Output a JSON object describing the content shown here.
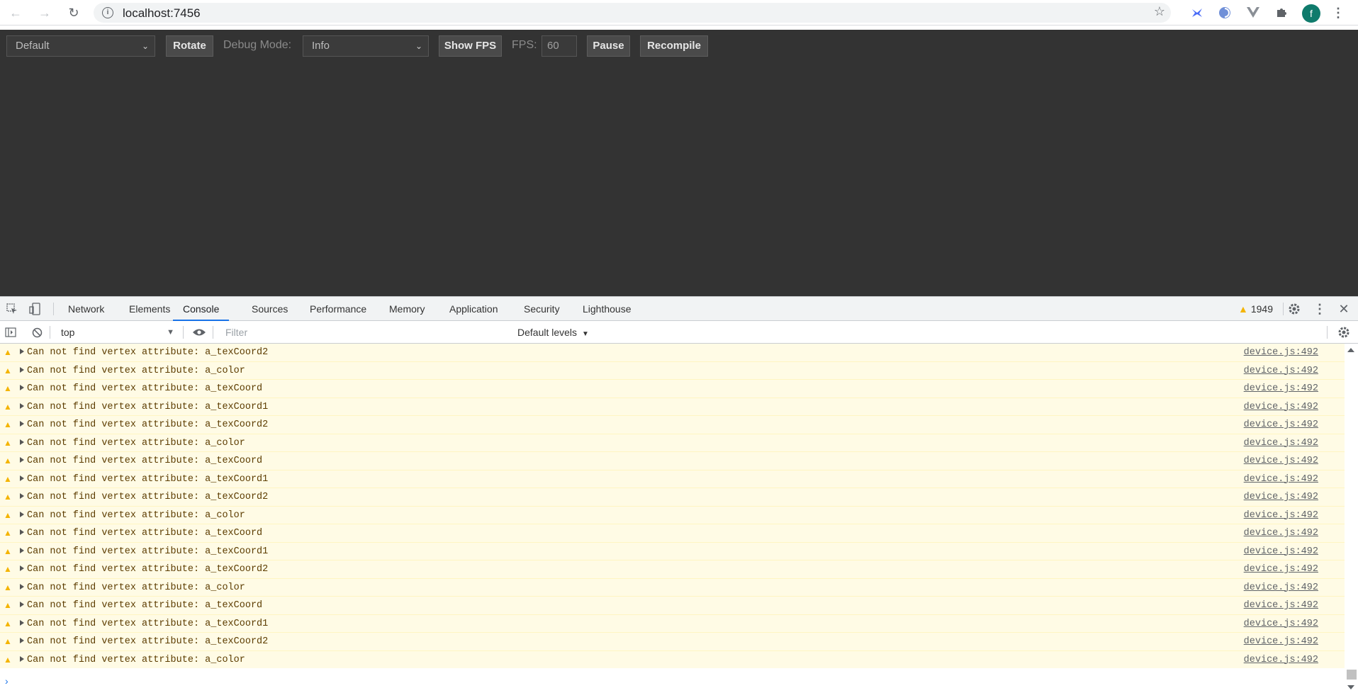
{
  "browser": {
    "url": "localhost:7456",
    "avatar_letter": "f"
  },
  "preview": {
    "scene_select": "Default",
    "rotate_label": "Rotate",
    "debug_mode_label": "Debug Mode:",
    "debug_mode_select": "Info",
    "show_fps_label": "Show FPS",
    "fps_label": "FPS:",
    "fps_value": "60",
    "pause_label": "Pause",
    "recompile_label": "Recompile"
  },
  "devtools": {
    "tabs": [
      "Network",
      "Elements",
      "Console",
      "Sources",
      "Performance",
      "Memory",
      "Application",
      "Security",
      "Lighthouse"
    ],
    "active_tab": "Console",
    "warning_count": "1949",
    "context": "top",
    "filter_placeholder": "Filter",
    "levels_label": "Default levels"
  },
  "console": {
    "messages": [
      {
        "text": "Can not find vertex attribute: a_texCoord2",
        "source": "device.js:492"
      },
      {
        "text": "Can not find vertex attribute: a_color",
        "source": "device.js:492"
      },
      {
        "text": "Can not find vertex attribute: a_texCoord",
        "source": "device.js:492"
      },
      {
        "text": "Can not find vertex attribute: a_texCoord1",
        "source": "device.js:492"
      },
      {
        "text": "Can not find vertex attribute: a_texCoord2",
        "source": "device.js:492"
      },
      {
        "text": "Can not find vertex attribute: a_color",
        "source": "device.js:492"
      },
      {
        "text": "Can not find vertex attribute: a_texCoord",
        "source": "device.js:492"
      },
      {
        "text": "Can not find vertex attribute: a_texCoord1",
        "source": "device.js:492"
      },
      {
        "text": "Can not find vertex attribute: a_texCoord2",
        "source": "device.js:492"
      },
      {
        "text": "Can not find vertex attribute: a_color",
        "source": "device.js:492"
      },
      {
        "text": "Can not find vertex attribute: a_texCoord",
        "source": "device.js:492"
      },
      {
        "text": "Can not find vertex attribute: a_texCoord1",
        "source": "device.js:492"
      },
      {
        "text": "Can not find vertex attribute: a_texCoord2",
        "source": "device.js:492"
      },
      {
        "text": "Can not find vertex attribute: a_color",
        "source": "device.js:492"
      },
      {
        "text": "Can not find vertex attribute: a_texCoord",
        "source": "device.js:492"
      },
      {
        "text": "Can not find vertex attribute: a_texCoord1",
        "source": "device.js:492"
      },
      {
        "text": "Can not find vertex attribute: a_texCoord2",
        "source": "device.js:492"
      },
      {
        "text": "Can not find vertex attribute: a_color",
        "source": "device.js:492"
      }
    ]
  },
  "colors": {
    "preview_bg": "#333333",
    "warning_bg": "#fffbe5",
    "warning_icon": "#f4b400",
    "active_tab_underline": "#1a73e8"
  }
}
